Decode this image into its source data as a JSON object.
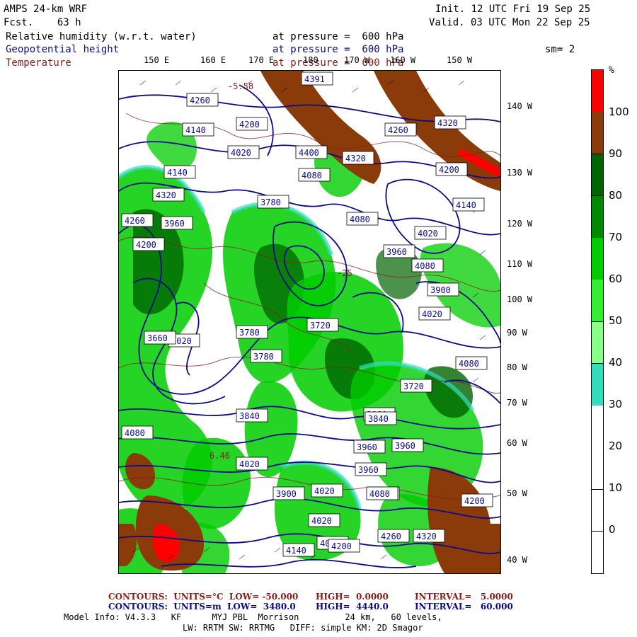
{
  "header": {
    "model_title": "AMPS 24-km WRF",
    "forecast": "Fcst.    63 h",
    "init": "Init. 12 UTC Fri 19 Sep 25",
    "valid": "Valid. 03 UTC Mon 22 Sep 25",
    "field1_name": "Relative humidity (w.r.t. water)",
    "field1_level": "at pressure =  600 hPa",
    "field2_name": "Geopotential height",
    "field2_level": "at pressure =  600 hPa",
    "field3_name": "Temperature",
    "field3_level": "at pressure =  600 hPa",
    "smoothing": "sm= 2"
  },
  "longitude_labels": [
    "150 E",
    "160 E",
    "170 E",
    "180",
    "170 W",
    "160 W",
    "150 W"
  ],
  "latitude_labels": [
    "140 W",
    "130 W",
    "120 W",
    "110 W",
    "100 W",
    "90 W",
    "80 W",
    "70 W",
    "60 W",
    "50 W",
    "40 W"
  ],
  "colorbar": {
    "unit": "%",
    "labels": [
      "100",
      "90",
      "80",
      "70",
      "60",
      "50",
      "40",
      "30",
      "20",
      "10",
      "0"
    ],
    "colors": [
      "#ff0000",
      "#8b3a0a",
      "#006400",
      "#008800",
      "#00cc00",
      "#33ee33",
      "#88ff88",
      "#33ddbb",
      "#ffffff",
      "#ffffff",
      "#ffffff",
      "#ffffff"
    ]
  },
  "map": {
    "height_contour_labels": [
      "4391",
      "4260",
      "4140",
      "4200",
      "4020",
      "4140",
      "4080",
      "4320",
      "4260",
      "4400",
      "4320",
      "4260",
      "4200",
      "4320",
      "3960",
      "4080",
      "4140",
      "3780",
      "4020",
      "4080",
      "4200",
      "4020",
      "3900",
      "3960",
      "4080",
      "4020",
      "3780",
      "3720",
      "3960",
      "3660",
      "3720",
      "3780",
      "3840",
      "3960",
      "4080",
      "3840",
      "3960",
      "4020",
      "3900",
      "3960",
      "4020",
      "4080",
      "4020",
      "4080",
      "4200",
      "4140",
      "4260",
      "4320",
      "4080",
      "4200"
    ],
    "temperature_contour_labels": [
      "-5.58",
      "6.46",
      "-25"
    ]
  },
  "footer": {
    "line1_contours": "CONTOURS:  UNITS=°C  LOW= -50.000",
    "line1_high": "HIGH=  0.0000",
    "line1_interval": "INTERVAL=   5.0000",
    "line2_contours": "CONTOURS:  UNITS=m  LOW=  3480.0",
    "line2_high": "HIGH=  4440.0",
    "line2_interval": "INTERVAL=   60.000",
    "model_info": "Model Info: V4.3.3   KF      MYJ PBL  Morrison         24 km,   60 levels,",
    "physics": "LW: RRTM SW: RRTMG   DIFF: simple KM: 2D Smagor"
  }
}
